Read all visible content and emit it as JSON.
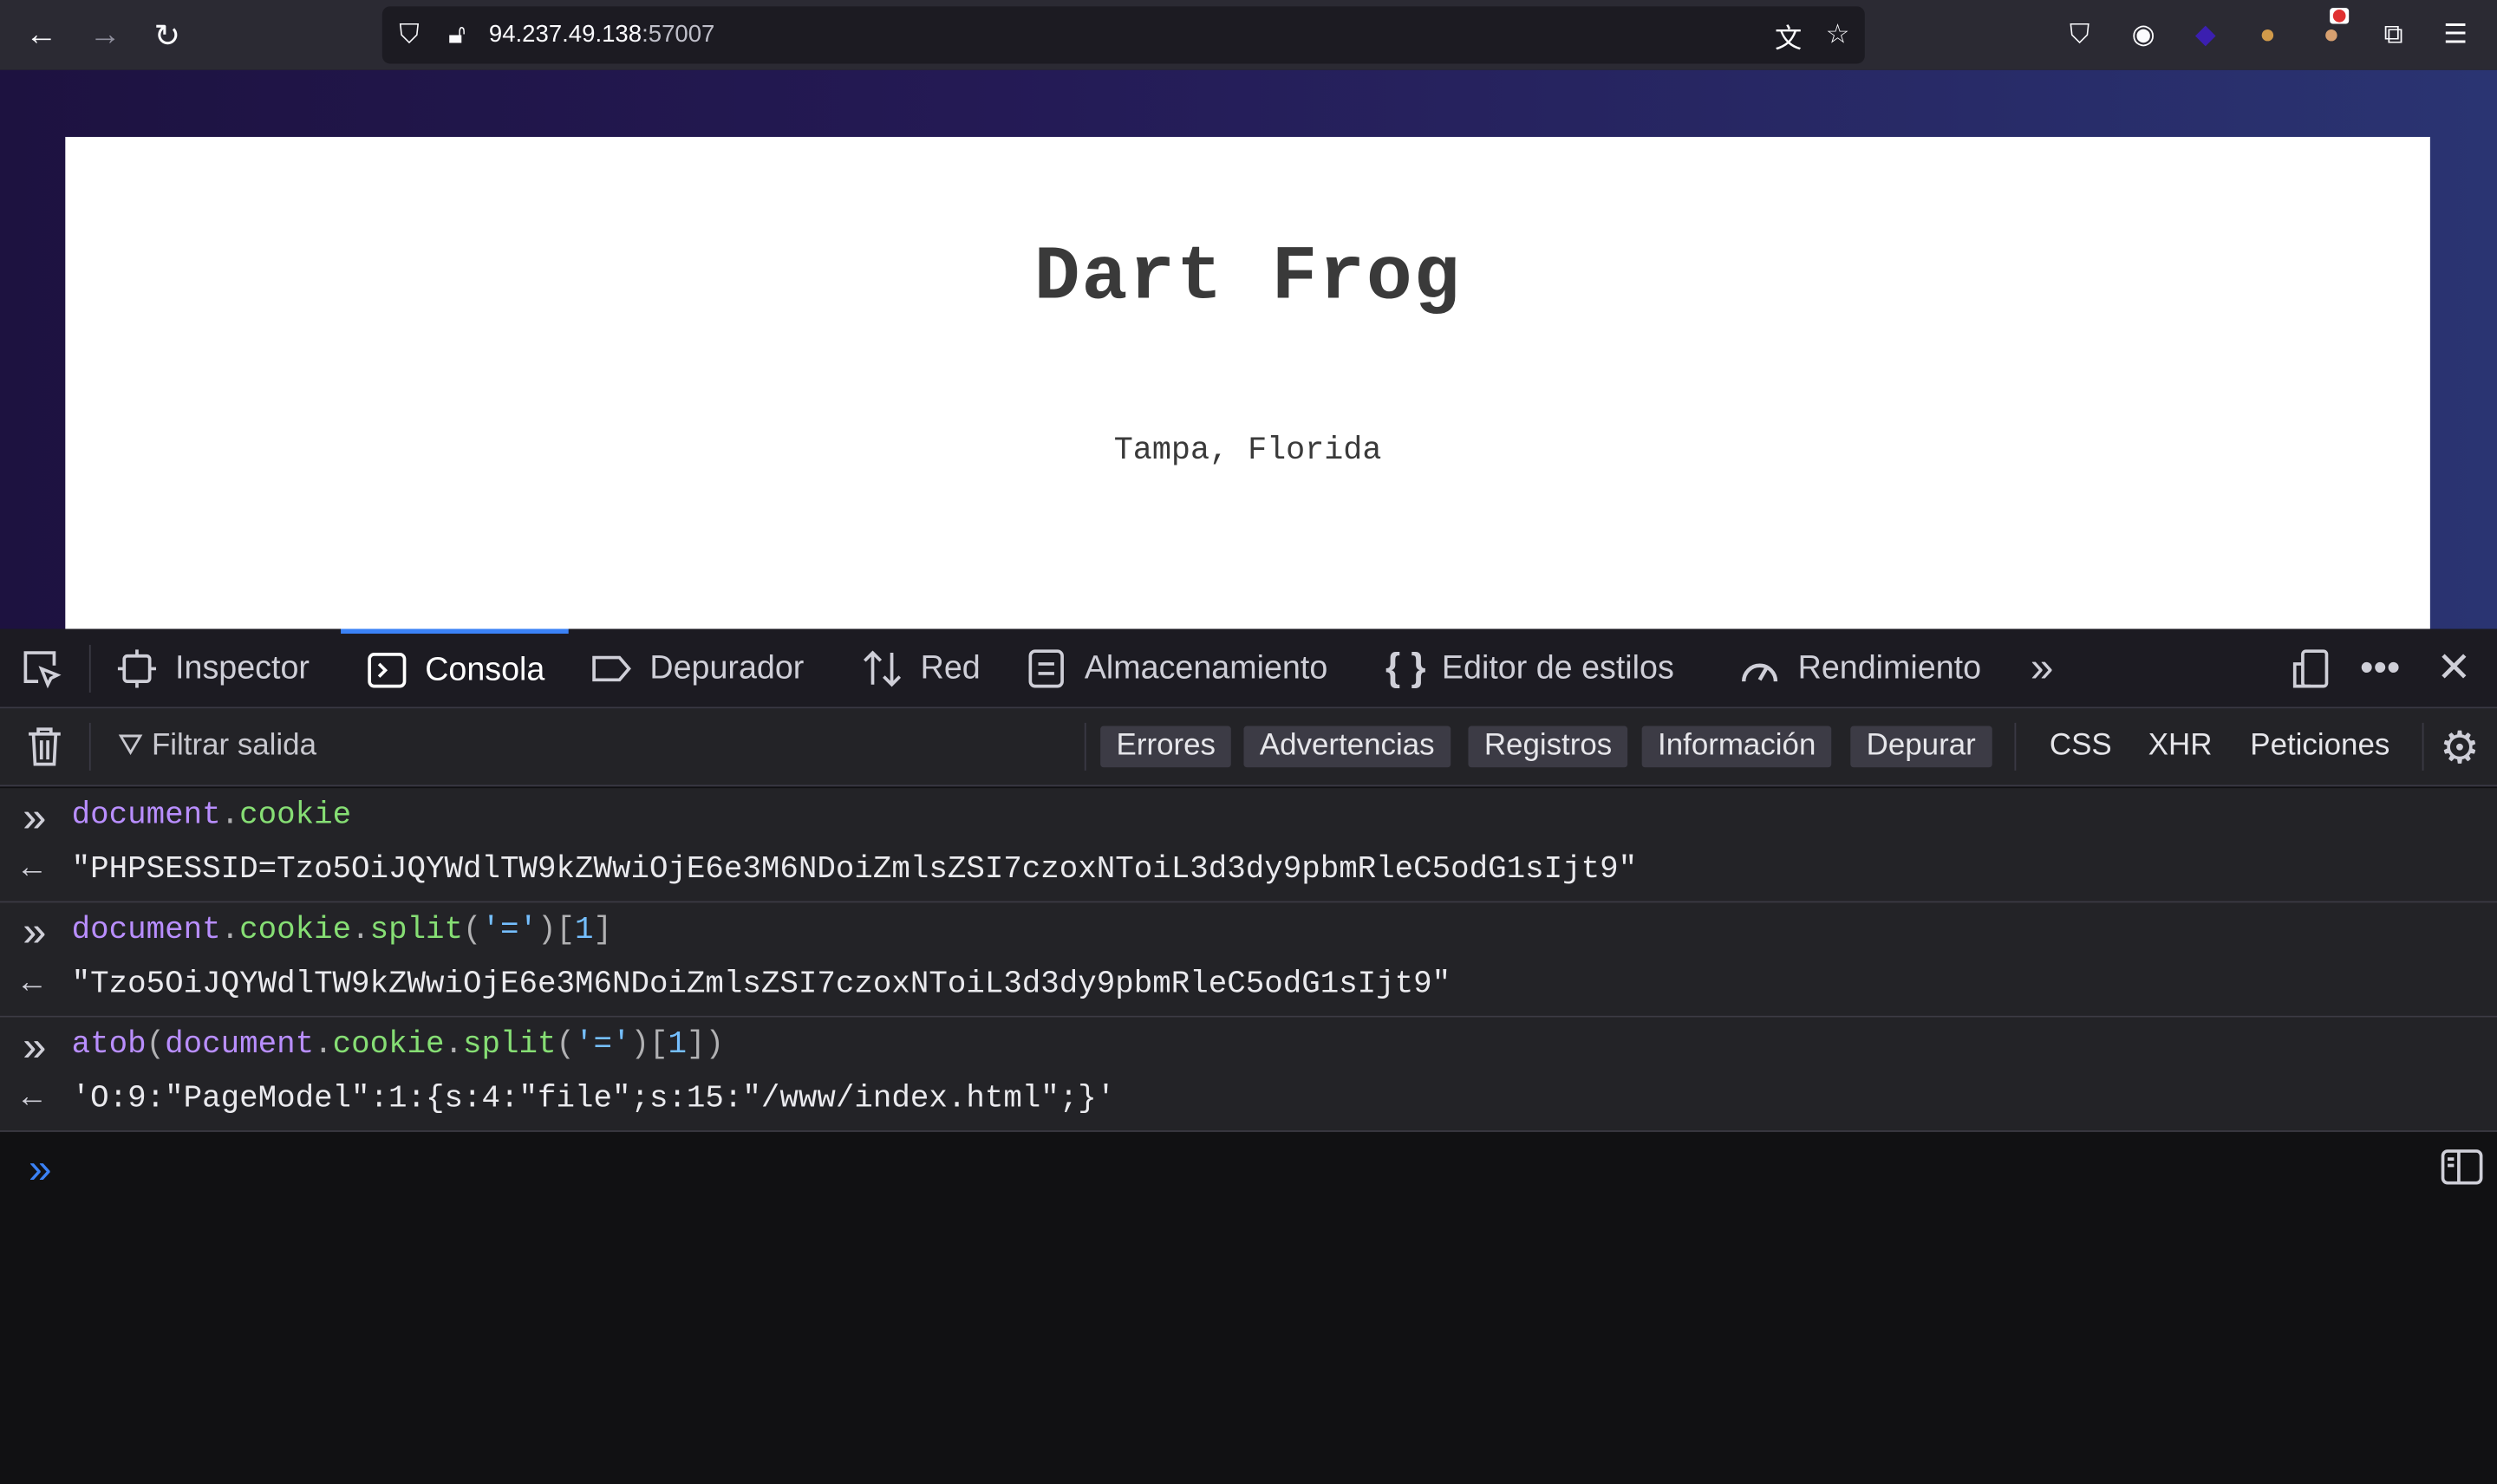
{
  "browser": {
    "url_host": "94.237.49.138",
    "url_port": ":57007",
    "icons": [
      "back-icon",
      "forward-icon",
      "reload-icon",
      "shield-icon",
      "lock-insecure-icon",
      "translate-icon",
      "star-icon",
      "pocket-icon",
      "account-icon",
      "layers-extension-icon",
      "cookie-extension-icon",
      "foxy-extension-icon",
      "extensions-icon",
      "menu-icon"
    ]
  },
  "page": {
    "title": "Dart Frog",
    "subtitle": "Tampa, Florida"
  },
  "devtools": {
    "tabs": [
      {
        "label": "Inspector",
        "icon": "inspector-icon"
      },
      {
        "label": "Consola",
        "icon": "console-icon",
        "active": true
      },
      {
        "label": "Depurador",
        "icon": "debugger-icon"
      },
      {
        "label": "Red",
        "icon": "network-icon"
      },
      {
        "label": "Almacenamiento",
        "icon": "storage-icon"
      },
      {
        "label": "Editor de estilos",
        "icon": "style-editor-icon"
      },
      {
        "label": "Rendimiento",
        "icon": "performance-icon"
      }
    ],
    "filter_placeholder": "Filtrar salida",
    "filters": [
      "Errores",
      "Advertencias",
      "Registros",
      "Información",
      "Depurar"
    ],
    "extra_filters": [
      "CSS",
      "XHR",
      "Peticiones"
    ],
    "accent": "#3b82f6"
  },
  "console": {
    "entries": [
      {
        "input": [
          "document",
          ".",
          "cookie"
        ],
        "output": "\"PHPSESSID=Tzo5OiJQYWdlTW9kZWwiOjE6e3M6NDoiZmlsZSI7czoxNToiL3d3dy9pbmRleC5odG1sIjt9\""
      },
      {
        "input": [
          "document",
          ".",
          "cookie",
          ".",
          "split",
          "(",
          "'='",
          ")",
          "[",
          "1",
          "]"
        ],
        "output": "\"Tzo5OiJQYWdlTW9kZWwiOjE6e3M6NDoiZmlsZSI7czoxNToiL3d3dy9pbmRleC5odG1sIjt9\""
      },
      {
        "input": [
          "atob",
          "(",
          "document",
          ".",
          "cookie",
          ".",
          "split",
          "(",
          "'='",
          ")",
          "[",
          "1",
          "]",
          ")"
        ],
        "output": "'O:9:\"PageModel\":1:{s:4:\"file\";s:15:\"/www/index.html\";}'"
      }
    ]
  }
}
